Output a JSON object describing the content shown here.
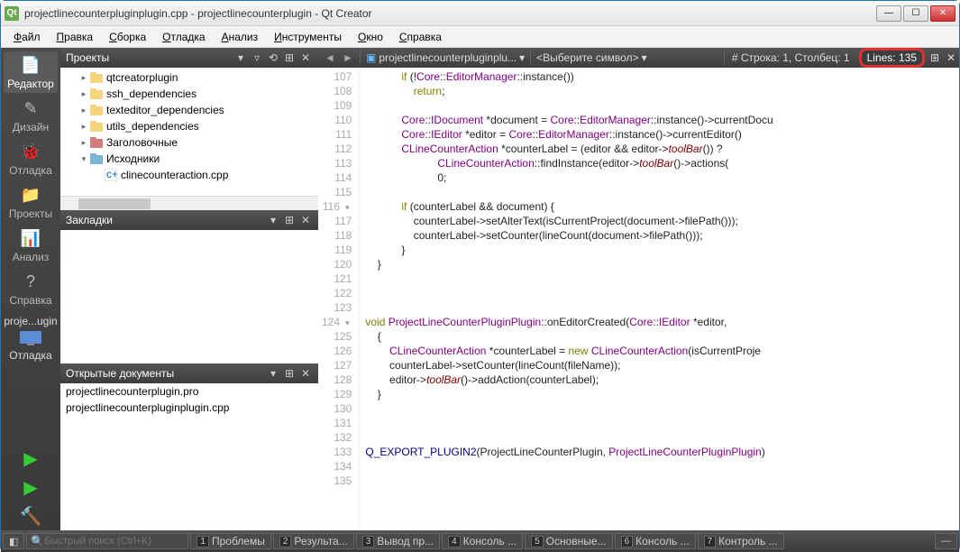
{
  "window": {
    "title": "projectlinecounterpluginplugin.cpp - projectlinecounterplugin - Qt Creator"
  },
  "menu": [
    "Файл",
    "Правка",
    "Сборка",
    "Отладка",
    "Анализ",
    "Инструменты",
    "Окно",
    "Справка"
  ],
  "modes": [
    {
      "label": "Редактор",
      "icon": "📄",
      "active": true
    },
    {
      "label": "Дизайн",
      "icon": "✎",
      "active": false
    },
    {
      "label": "Отладка",
      "icon": "🐞",
      "active": false
    },
    {
      "label": "Проекты",
      "icon": "📁",
      "active": false
    },
    {
      "label": "Анализ",
      "icon": "📊",
      "active": false
    },
    {
      "label": "Справка",
      "icon": "?",
      "active": false
    }
  ],
  "target": {
    "kit": "proje...ugin",
    "device": "Отладка"
  },
  "panes": {
    "projects": {
      "title": "Проекты",
      "items": [
        {
          "indent": 1,
          "tw": "▸",
          "icon": "folder",
          "label": "qtcreatorplugin"
        },
        {
          "indent": 1,
          "tw": "▸",
          "icon": "folder",
          "label": "ssh_dependencies"
        },
        {
          "indent": 1,
          "tw": "▸",
          "icon": "folder",
          "label": "texteditor_dependencies"
        },
        {
          "indent": 1,
          "tw": "▸",
          "icon": "folder",
          "label": "utils_dependencies"
        },
        {
          "indent": 1,
          "tw": "▸",
          "icon": "folder-h",
          "label": "Заголовочные"
        },
        {
          "indent": 1,
          "tw": "▾",
          "icon": "folder-c",
          "label": "Исходники"
        },
        {
          "indent": 2,
          "tw": "",
          "icon": "cpp",
          "label": "clinecounteraction.cpp"
        }
      ]
    },
    "bookmarks": {
      "title": "Закладки"
    },
    "opendocs": {
      "title": "Открытые документы",
      "items": [
        "projectlinecounterplugin.pro",
        "projectlinecounterpluginplugin.cpp"
      ]
    }
  },
  "editor": {
    "file": "projectlinecounterpluginplu...",
    "symbol": "<Выберите символ>",
    "pos": "Строка: 1, Столбец: 1",
    "lines": "Lines: 135",
    "startLine": 107,
    "code": [
      "            if (!Core::EditorManager::instance())",
      "                return;",
      "",
      "            Core::IDocument *document = Core::EditorManager::instance()->currentDocu",
      "            Core::IEditor *editor = Core::EditorManager::instance()->currentEditor()",
      "            CLineCounterAction *counterLabel = (editor && editor->toolBar()) ?",
      "                        CLineCounterAction::findInstance(editor->toolBar()->actions(",
      "                        0;",
      "",
      "            if (counterLabel && document) {",
      "                counterLabel->setAlterText(isCurrentProject(document->filePath()));",
      "                counterLabel->setCounter(lineCount(document->filePath()));",
      "            }",
      "    }",
      "",
      "",
      "",
      "void ProjectLineCounterPluginPlugin::onEditorCreated(Core::IEditor *editor,",
      "    {",
      "        CLineCounterAction *counterLabel = new CLineCounterAction(isCurrentProje",
      "        counterLabel->setCounter(lineCount(fileName));",
      "        editor->toolBar()->addAction(counterLabel);",
      "    }",
      "",
      "",
      "",
      "Q_EXPORT_PLUGIN2(ProjectLineCounterPlugin, ProjectLineCounterPluginPlugin)",
      "",
      ""
    ]
  },
  "bottom": {
    "searchPlaceholder": "Быстрый поиск (Ctrl+K)",
    "panes": [
      {
        "n": "1",
        "l": "Проблемы"
      },
      {
        "n": "2",
        "l": "Результа..."
      },
      {
        "n": "3",
        "l": "Вывод пр..."
      },
      {
        "n": "4",
        "l": "Консоль ..."
      },
      {
        "n": "5",
        "l": "Основные..."
      },
      {
        "n": "6",
        "l": "Консоль ..."
      },
      {
        "n": "7",
        "l": "Контроль ..."
      }
    ]
  }
}
